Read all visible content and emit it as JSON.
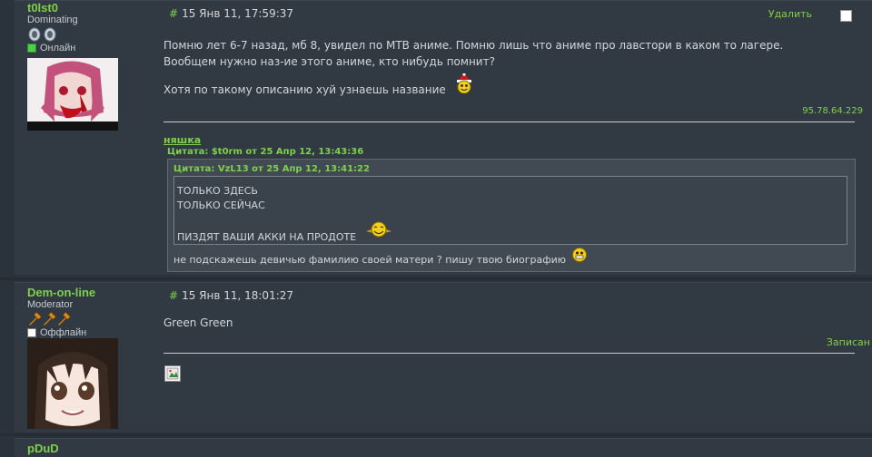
{
  "post1": {
    "username": "t0lst0",
    "rank": "Dominating",
    "status": "Онлайн",
    "header_hash": "#",
    "date": "15 Янв 11, 17:59:37",
    "delete_label": "Удалить",
    "body_line1": "Помню лет 6-7 назад, мб 8, увидел по МТВ аниме. Помню лишь что аниме про лавстори в каком то лагере.",
    "body_line2": "Вообщем нужно наз-ие этого аниме, кто нибудь помнит?",
    "body_line3": "Хотя по такому описанию хуй узнаешь название",
    "ip": "95.78.64.229",
    "signature": {
      "name": "няшка",
      "quote_outer_header": "Цитата: $t0rm от 25 Апр 12, 13:43:36",
      "quote_inner_header": "Цитата: VzL13 от 25 Апр 12, 13:41:22",
      "quote_inner_lines": [
        "ТОЛЬКО ЗДЕСЬ",
        "ТОЛЬКО СЕЙЧАС",
        "ПИЗДЯТ ВАШИ АККИ НА ПРОДОТЕ"
      ],
      "quote_reply": "не подскажешь девичью фамилию своей матери ? пишу твою биографию"
    }
  },
  "post2": {
    "username": "Dem-on-line",
    "rank": "Moderator",
    "status": "Оффлайн",
    "header_hash": "#",
    "date": "15 Янв 11, 18:01:27",
    "body": "Green Green",
    "recorded_label": "Записан"
  },
  "post3": {
    "username": "pDuD"
  },
  "colors": {
    "accent": "#7fd04a",
    "background": "#2a323b",
    "post_bg": "#313a43",
    "text": "#d2d6da"
  }
}
